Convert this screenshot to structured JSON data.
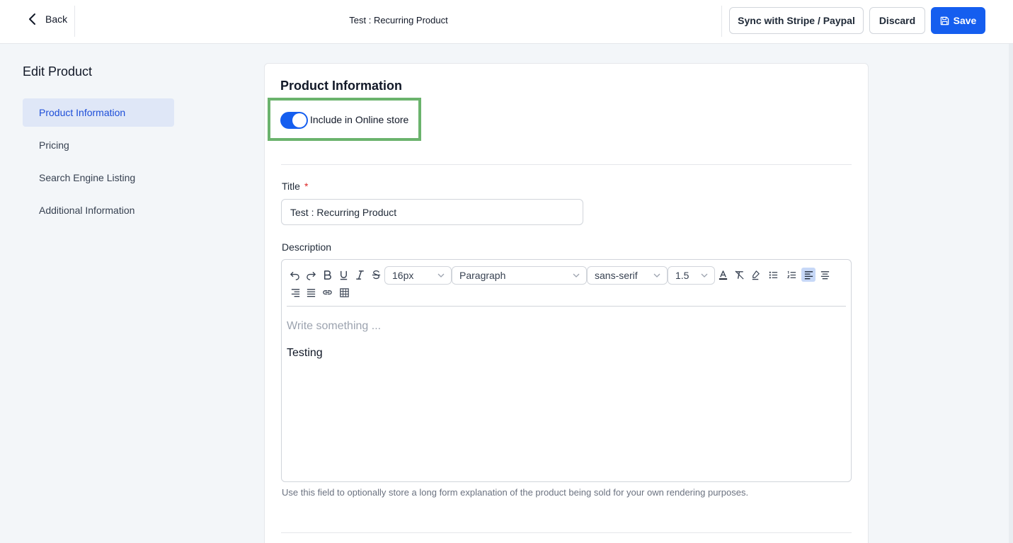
{
  "header": {
    "back_label": "Back",
    "page_title": "Test : Recurring Product",
    "sync_label": "Sync with Stripe / Paypal",
    "discard_label": "Discard",
    "save_label": "Save",
    "accent_color": "#155eef"
  },
  "sidebar": {
    "heading": "Edit Product",
    "items": [
      {
        "label": "Product Information",
        "active": true
      },
      {
        "label": "Pricing",
        "active": false
      },
      {
        "label": "Search Engine Listing",
        "active": false
      },
      {
        "label": "Additional Information",
        "active": false
      }
    ]
  },
  "main": {
    "section_title": "Product Information",
    "online_store": {
      "label": "Include in Online store",
      "enabled": true
    },
    "title_field": {
      "label": "Title",
      "required_mark": "*",
      "value": "Test : Recurring Product"
    },
    "description": {
      "label": "Description",
      "toolbar": {
        "font_size": "16px",
        "block_type": "Paragraph",
        "font_family": "sans-serif",
        "line_height": "1.5",
        "icons": [
          "undo-icon",
          "redo-icon",
          "bold-icon",
          "underline-icon",
          "italic-icon",
          "strikethrough-icon",
          "text-color-icon",
          "clear-format-icon",
          "highlight-icon",
          "bullet-list-icon",
          "numbered-list-icon",
          "align-left-icon",
          "align-center-icon",
          "align-right-icon",
          "align-justify-icon",
          "link-icon",
          "table-icon"
        ]
      },
      "placeholder": "Write something ...",
      "content": "Testing",
      "help_text": "Use this field to optionally store a long form explanation of the product being sold for your own rendering purposes."
    },
    "highlight_color": "#6bb36d"
  }
}
